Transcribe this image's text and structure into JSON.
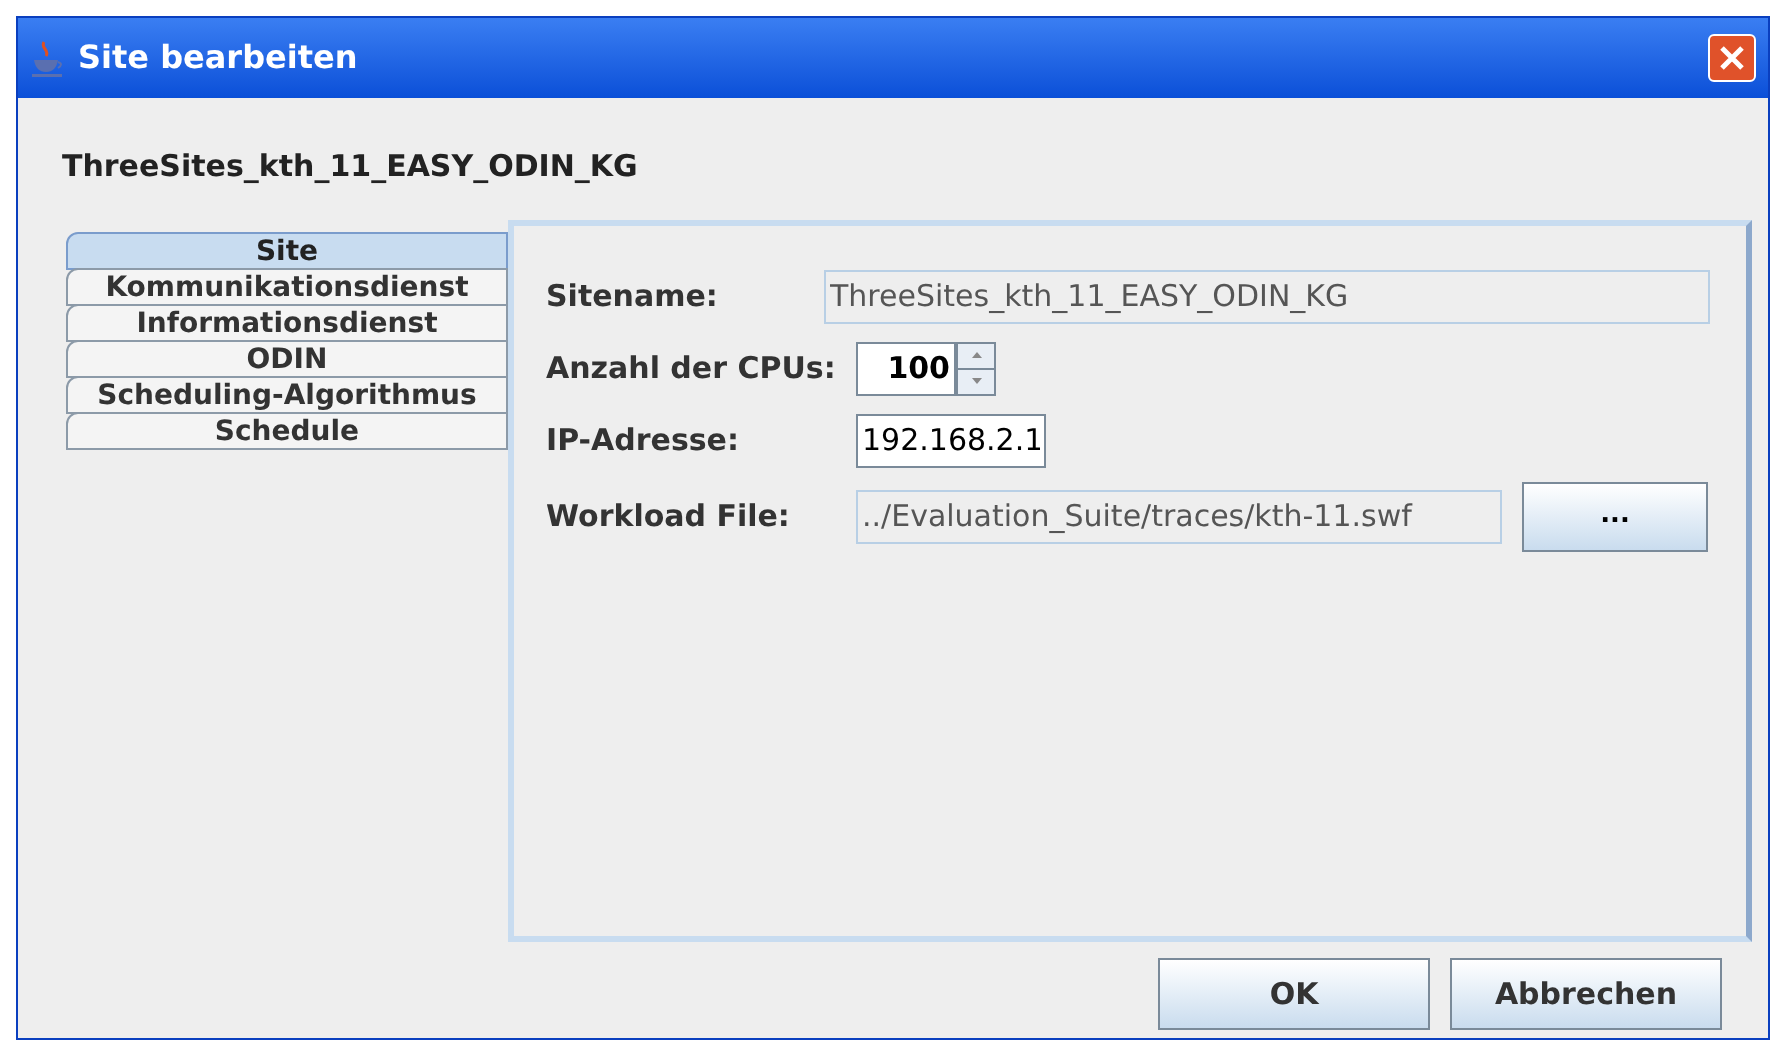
{
  "window": {
    "title": "Site bearbeiten"
  },
  "heading": "ThreeSites_kth_11_EASY_ODIN_KG",
  "tabs": [
    {
      "label": "Site",
      "selected": true
    },
    {
      "label": "Kommunikationsdienst",
      "selected": false
    },
    {
      "label": "Informationsdienst",
      "selected": false
    },
    {
      "label": "ODIN",
      "selected": false
    },
    {
      "label": "Scheduling-Algorithmus",
      "selected": false
    },
    {
      "label": "Schedule",
      "selected": false
    }
  ],
  "fields": [
    {
      "kind": "text",
      "label": "Sitename:",
      "value": "ThreeSites_kth_11_EASY_ODIN_KG",
      "editable": false
    },
    {
      "kind": "spinner",
      "label": "Anzahl der CPUs:",
      "value": "100",
      "editable": true
    },
    {
      "kind": "text",
      "label": "IP-Adresse:",
      "value": "192.168.2.1",
      "editable": true
    },
    {
      "kind": "file",
      "label": "Workload File:",
      "value": "../Evaluation_Suite/traces/kth-11.swf",
      "editable": false,
      "button": "..."
    }
  ],
  "buttons": [
    "OK",
    "Abbrechen"
  ]
}
